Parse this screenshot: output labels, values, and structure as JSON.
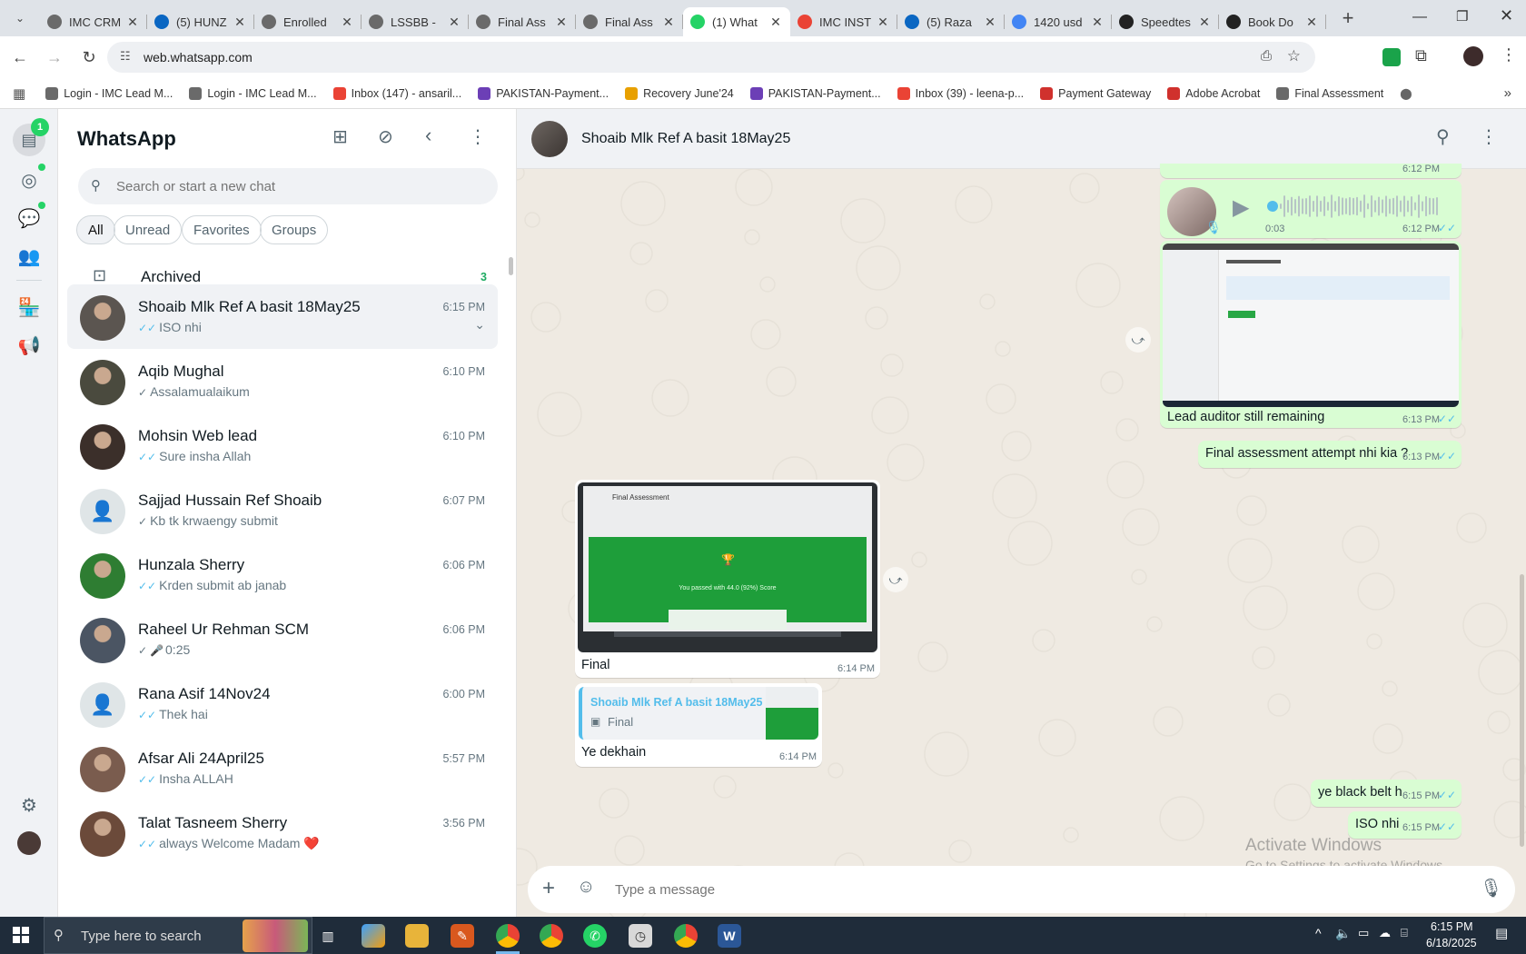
{
  "browser": {
    "tabs": [
      {
        "title": "IMC CRM",
        "icon_color": "#6a6a6a"
      },
      {
        "title": "(5) HUNZ",
        "icon_color": "#0a66c2"
      },
      {
        "title": "Enrolled",
        "icon_color": "#6a6a6a"
      },
      {
        "title": "LSSBB -",
        "icon_color": "#6a6a6a"
      },
      {
        "title": "Final Ass",
        "icon_color": "#6a6a6a"
      },
      {
        "title": "Final Ass",
        "icon_color": "#6a6a6a"
      },
      {
        "title": "(1) What",
        "icon_color": "#25d366",
        "active": true
      },
      {
        "title": "IMC INST",
        "icon_color": "#ea4335"
      },
      {
        "title": "(5) Raza",
        "icon_color": "#0a66c2"
      },
      {
        "title": "1420 usd",
        "icon_color": "#4285f4"
      },
      {
        "title": "Speedtes",
        "icon_color": "#222222"
      },
      {
        "title": "Book Do",
        "icon_color": "#222222"
      }
    ],
    "url": "web.whatsapp.com",
    "bookmarks": [
      {
        "label": "Login - IMC Lead M...",
        "color": "#6a6a6a"
      },
      {
        "label": "Login - IMC Lead M...",
        "color": "#6a6a6a"
      },
      {
        "label": "Inbox (147) - ansaril...",
        "color": "#ea4335"
      },
      {
        "label": "PAKISTAN-Payment...",
        "color": "#6c3fb6"
      },
      {
        "label": "Recovery June'24",
        "color": "#e8a000"
      },
      {
        "label": "PAKISTAN-Payment...",
        "color": "#6c3fb6"
      },
      {
        "label": "Inbox (39) - leena-p...",
        "color": "#ea4335"
      },
      {
        "label": "Payment Gateway",
        "color": "#d0312d"
      },
      {
        "label": "Adobe Acrobat",
        "color": "#d0312d"
      },
      {
        "label": "Final Assessment",
        "color": "#6a6a6a"
      }
    ]
  },
  "sidebar": {
    "badge": "1",
    "app_title": "WhatsApp",
    "search_placeholder": "Search or start a new chat",
    "filters": [
      "All",
      "Unread",
      "Favorites",
      "Groups"
    ],
    "archived_label": "Archived",
    "archived_count": "3",
    "chats": [
      {
        "name": "Shoaib Mlk Ref A basit 18May25",
        "time": "6:15 PM",
        "message": "ISO nhi",
        "tick": "read",
        "avatar": "#5b5550",
        "selected": true
      },
      {
        "name": "Aqib Mughal",
        "time": "6:10 PM",
        "message": "Assalamualaikum",
        "tick": "sent",
        "avatar": "#4a4a3e"
      },
      {
        "name": "Mohsin Web lead",
        "time": "6:10 PM",
        "message": "Sure insha Allah",
        "tick": "read",
        "avatar": "#3b2f2a"
      },
      {
        "name": "Sajjad Hussain Ref Shoaib",
        "time": "6:07 PM",
        "message": "Kb tk krwaengy submit",
        "tick": "sent",
        "avatar": "default"
      },
      {
        "name": "Hunzala Sherry",
        "time": "6:06 PM",
        "message": "Krden submit ab janab",
        "tick": "read",
        "avatar": "#2e7d32"
      },
      {
        "name": "Raheel Ur Rehman SCM",
        "time": "6:06 PM",
        "message": "0:25",
        "tick": "sent",
        "mic": true,
        "avatar": "#4b5563"
      },
      {
        "name": "Rana Asif 14Nov24",
        "time": "6:00 PM",
        "message": "Thek hai",
        "tick": "read",
        "avatar": "default"
      },
      {
        "name": "Afsar Ali 24April25",
        "time": "5:57 PM",
        "message": "Insha ALLAH",
        "tick": "read",
        "avatar": "#7a5c4e"
      },
      {
        "name": "Talat Tasneem Sherry",
        "time": "3:56 PM",
        "message": "always Welcome Madam ❤️",
        "tick": "read",
        "avatar": "#6b4a3a"
      }
    ]
  },
  "chat": {
    "contact_name": "Shoaib Mlk Ref A basit 18May25",
    "top_partial_time": "6:12 PM",
    "voice_duration": "0:03",
    "voice_time": "6:12 PM",
    "screenshot_caption": "Lead auditor still remaining",
    "screenshot_time": "6:13 PM",
    "msg_final_assessment": "Final assessment attempt nhi kia ?",
    "msg_final_assessment_time": "6:13 PM",
    "photo_caption": "Final",
    "photo_time": "6:14 PM",
    "photo_overlay_title": "Final Assessment",
    "photo_overlay_text": "You passed with 44.0 (92%) Score",
    "reply_quote_name": "Shoaib Mlk Ref A basit 18May25",
    "reply_quote_text": "Final",
    "reply_text": "Ye dekhain",
    "reply_time": "6:14 PM",
    "msg_black_belt": "ye black belt h",
    "msg_black_belt_time": "6:15 PM",
    "msg_iso": "ISO nhi",
    "msg_iso_time": "6:15 PM",
    "composer_placeholder": "Type a message",
    "watermark_title": "Activate Windows",
    "watermark_sub": "Go to Settings to activate Windows."
  },
  "taskbar": {
    "search_placeholder": "Type here to search",
    "time": "6:15 PM",
    "date": "6/18/2025"
  },
  "colors": {
    "accent_green": "#25d366",
    "outgoing_bubble": "#d9fdd3",
    "read_tick": "#53bdeb",
    "chat_bg": "#efeae2"
  }
}
